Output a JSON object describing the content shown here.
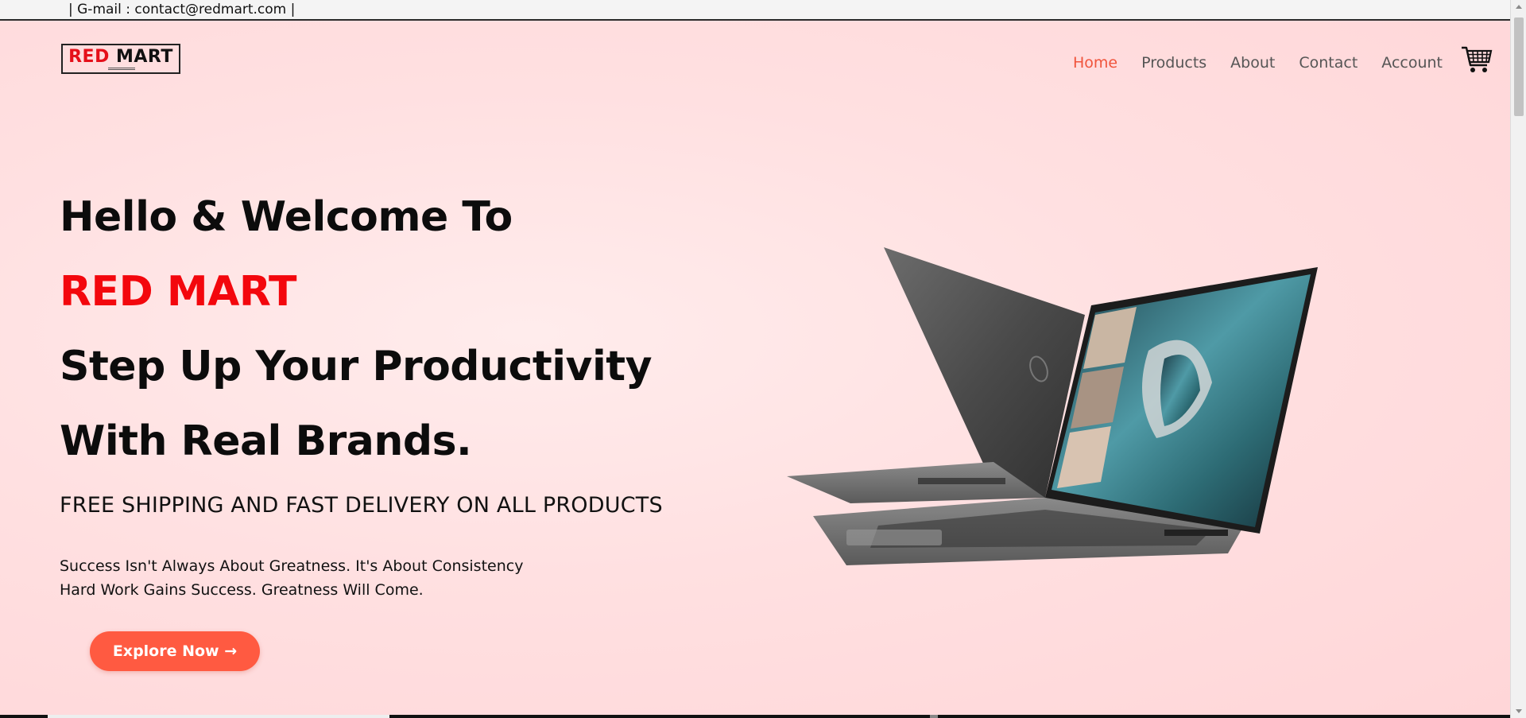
{
  "topbar": {
    "contact_text": "| G-mail : contact@redmart.com |"
  },
  "logo": {
    "red_text": "RED",
    "black_text": "MART"
  },
  "nav": {
    "items": [
      {
        "label": "Home",
        "active": true
      },
      {
        "label": "Products",
        "active": false
      },
      {
        "label": "About",
        "active": false
      },
      {
        "label": "Contact",
        "active": false
      },
      {
        "label": "Account",
        "active": false
      }
    ],
    "cart_icon": "shopping-cart-icon"
  },
  "hero": {
    "line1": "Hello & Welcome To",
    "brand": "RED MART",
    "line3": "Step Up Your Productivity",
    "line4": "With Real Brands.",
    "shipping": "FREE SHIPPING AND FAST DELIVERY ON ALL PRODUCTS",
    "sub1": "Success Isn't Always About Greatness. It's About Consistency",
    "sub2": "Hard Work Gains Success. Greatness Will Come.",
    "cta_label": "Explore Now →"
  },
  "colors": {
    "accent": "#f0543c",
    "brand_red": "#f3070d",
    "cta": "#ff5a41",
    "background": "#ffe3e4"
  }
}
